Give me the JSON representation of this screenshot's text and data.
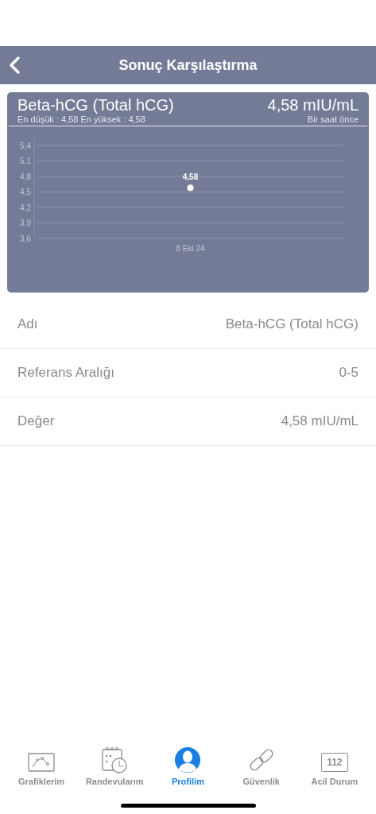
{
  "nav_bar": {
    "title": "Sonuç Karşılaştırma"
  },
  "result_card": {
    "title": "Beta-hCG (Total hCG)",
    "value": "4,58 mIU/mL",
    "range_summary": "En düşük : 4,58 En yüksek : 4,58",
    "time": "Bir saat önce",
    "chart_data": {
      "type": "scatter",
      "categories": [
        "8 Eki 24"
      ],
      "series": [
        {
          "color": "#ffffff",
          "values": [
            4.58
          ]
        }
      ],
      "grid": true,
      "ylim": [
        3.6,
        5.4
      ],
      "yticks": [
        {
          "value": 3.6,
          "label": "3,6"
        },
        {
          "value": 3.9,
          "label": "3,9"
        },
        {
          "value": 4.2,
          "label": "4,2"
        },
        {
          "value": 4.5,
          "label": "4,5"
        },
        {
          "value": 4.8,
          "label": "4,8"
        },
        {
          "value": 5.1,
          "label": "5,1"
        },
        {
          "value": 5.4,
          "label": "5,4"
        }
      ],
      "value_labels": [
        "4,58"
      ]
    }
  },
  "details": [
    {
      "label": "Adı",
      "value": "Beta-hCG (Total hCG)"
    },
    {
      "label": "Referans Aralığı",
      "value": "0-5"
    },
    {
      "label": "Değer",
      "value": "4,58 mIU/mL"
    }
  ],
  "tab_bar": [
    {
      "kind": "chart",
      "label": "Grafiklerim",
      "selected": false
    },
    {
      "kind": "calendar",
      "label": "Randevularım",
      "selected": false
    },
    {
      "kind": "profile",
      "label": "Profilim",
      "selected": true
    },
    {
      "kind": "link",
      "label": "Güvenlik",
      "selected": false
    },
    {
      "kind": "emergency",
      "label": "Acil Durum",
      "icon_text": "112",
      "selected": false
    }
  ]
}
